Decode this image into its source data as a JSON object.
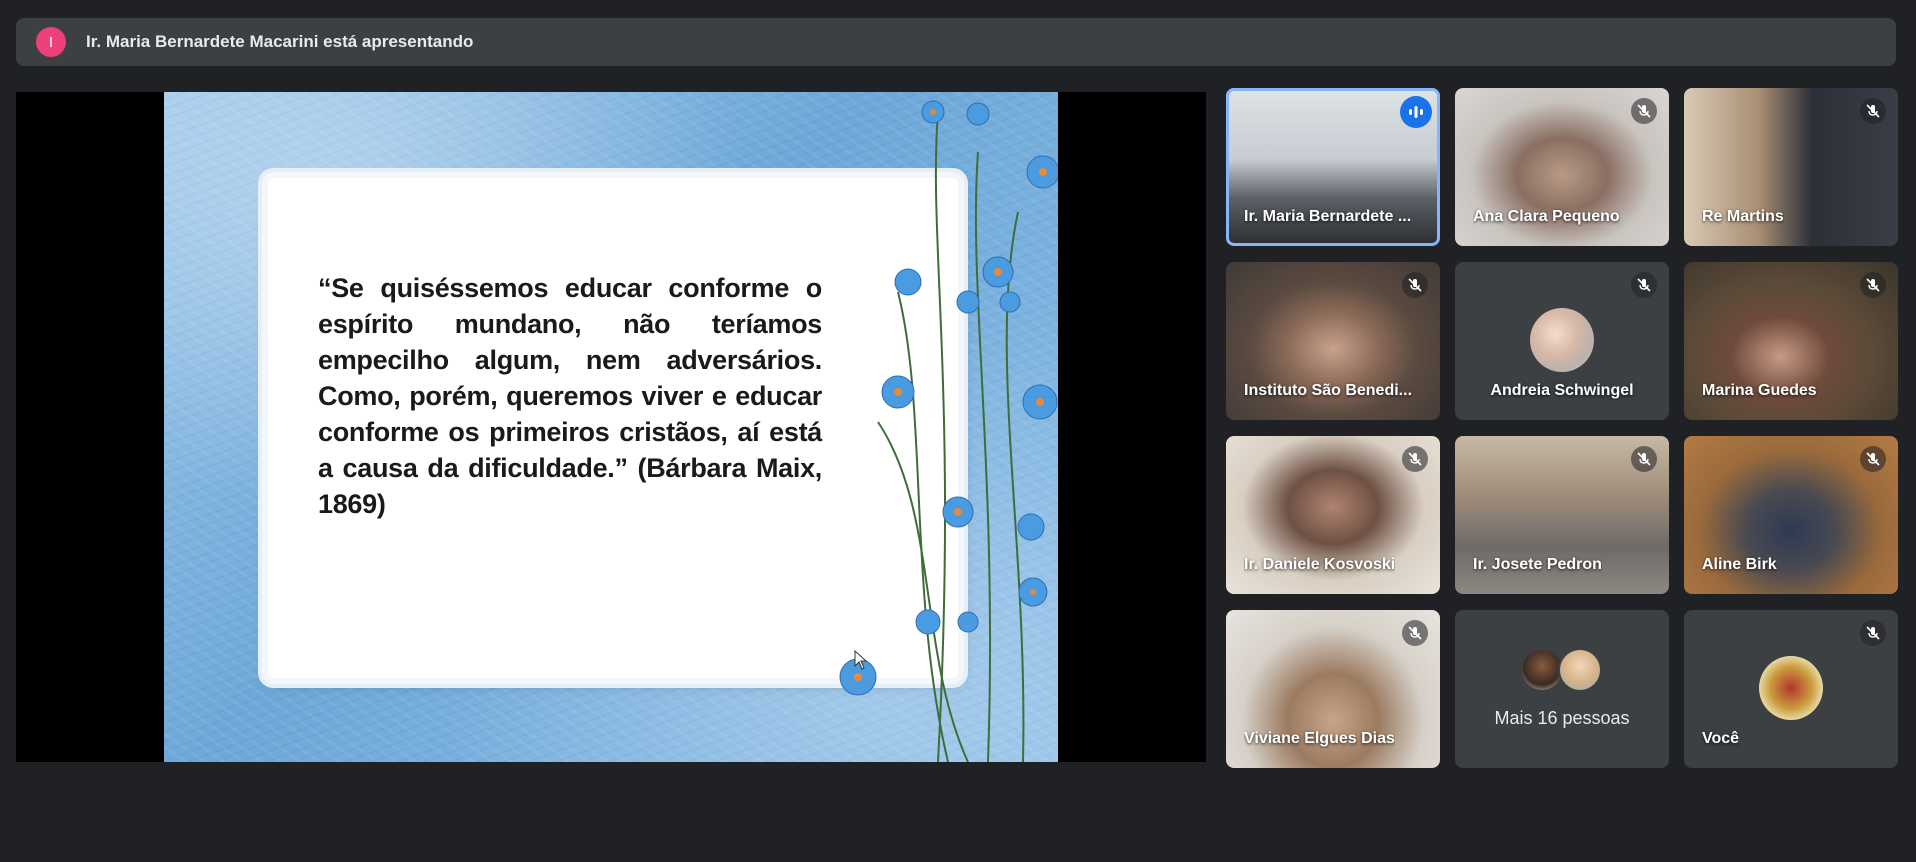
{
  "presenting": {
    "avatar_letter": "I",
    "text": "Ir. Maria Bernardete Macarini está apresentando"
  },
  "slide": {
    "quote": "“Se quiséssemos educar conforme o espírito mundano, não teríamos empecilho algum, nem adversários. Como, porém, queremos viver e educar conforme os primeiros cristãos, aí está a causa da dificuldade.”  (Bárbara Maix, 1869)"
  },
  "participants": [
    {
      "name": "Ir. Maria Bernardete ...",
      "state": "speaking"
    },
    {
      "name": "Ana Clara Pequeno",
      "state": "muted"
    },
    {
      "name": "Re Martins",
      "state": "muted"
    },
    {
      "name": "Instituto São Benedi...",
      "state": "muted"
    },
    {
      "name": "Andreia Schwingel",
      "state": "muted"
    },
    {
      "name": "Marina Guedes",
      "state": "muted"
    },
    {
      "name": "Ir. Daniele Kosvoski",
      "state": "muted"
    },
    {
      "name": "Ir. Josete Pedron",
      "state": "muted"
    },
    {
      "name": "Aline Birk",
      "state": "muted"
    },
    {
      "name": "Viviane Elgues Dias",
      "state": "muted"
    },
    {
      "name": "Você",
      "state": "muted"
    }
  ],
  "more": {
    "label": "Mais 16 pessoas"
  },
  "colors": {
    "background": "#202124",
    "tile": "#3c4043",
    "active_outline": "#8ab4f8",
    "speaking_badge": "#1a73e8",
    "presenter_avatar": "#ec407a"
  }
}
